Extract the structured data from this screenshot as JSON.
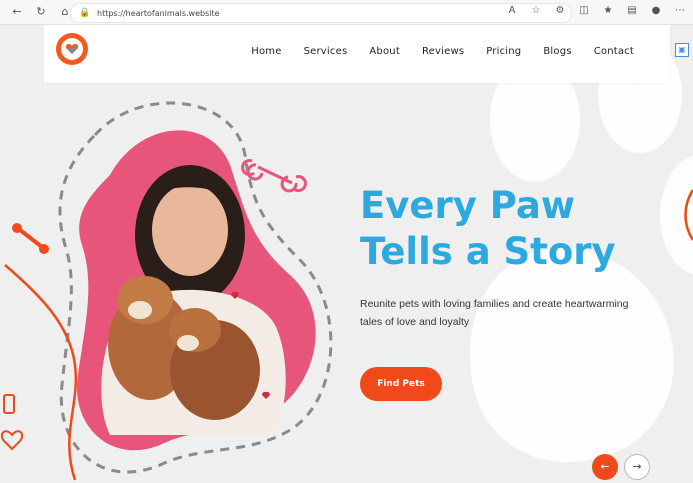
{
  "browser": {
    "url": "https://heartofanimals.website"
  },
  "nav": {
    "items": [
      {
        "label": "Home"
      },
      {
        "label": "Services"
      },
      {
        "label": "About"
      },
      {
        "label": "Reviews"
      },
      {
        "label": "Pricing"
      },
      {
        "label": "Blogs"
      },
      {
        "label": "Contact"
      }
    ]
  },
  "hero": {
    "title": "Every Paw Tells a Story",
    "subtitle": "Reunite pets with loving families and create heartwarming tales of love and loyalty",
    "cta_label": "Find Pets"
  },
  "colors": {
    "accent": "#f04a1b",
    "title": "#2da9df",
    "blob": "#e8557a"
  },
  "icons": {
    "prev": "arrow-left-icon",
    "next": "arrow-right-icon"
  }
}
